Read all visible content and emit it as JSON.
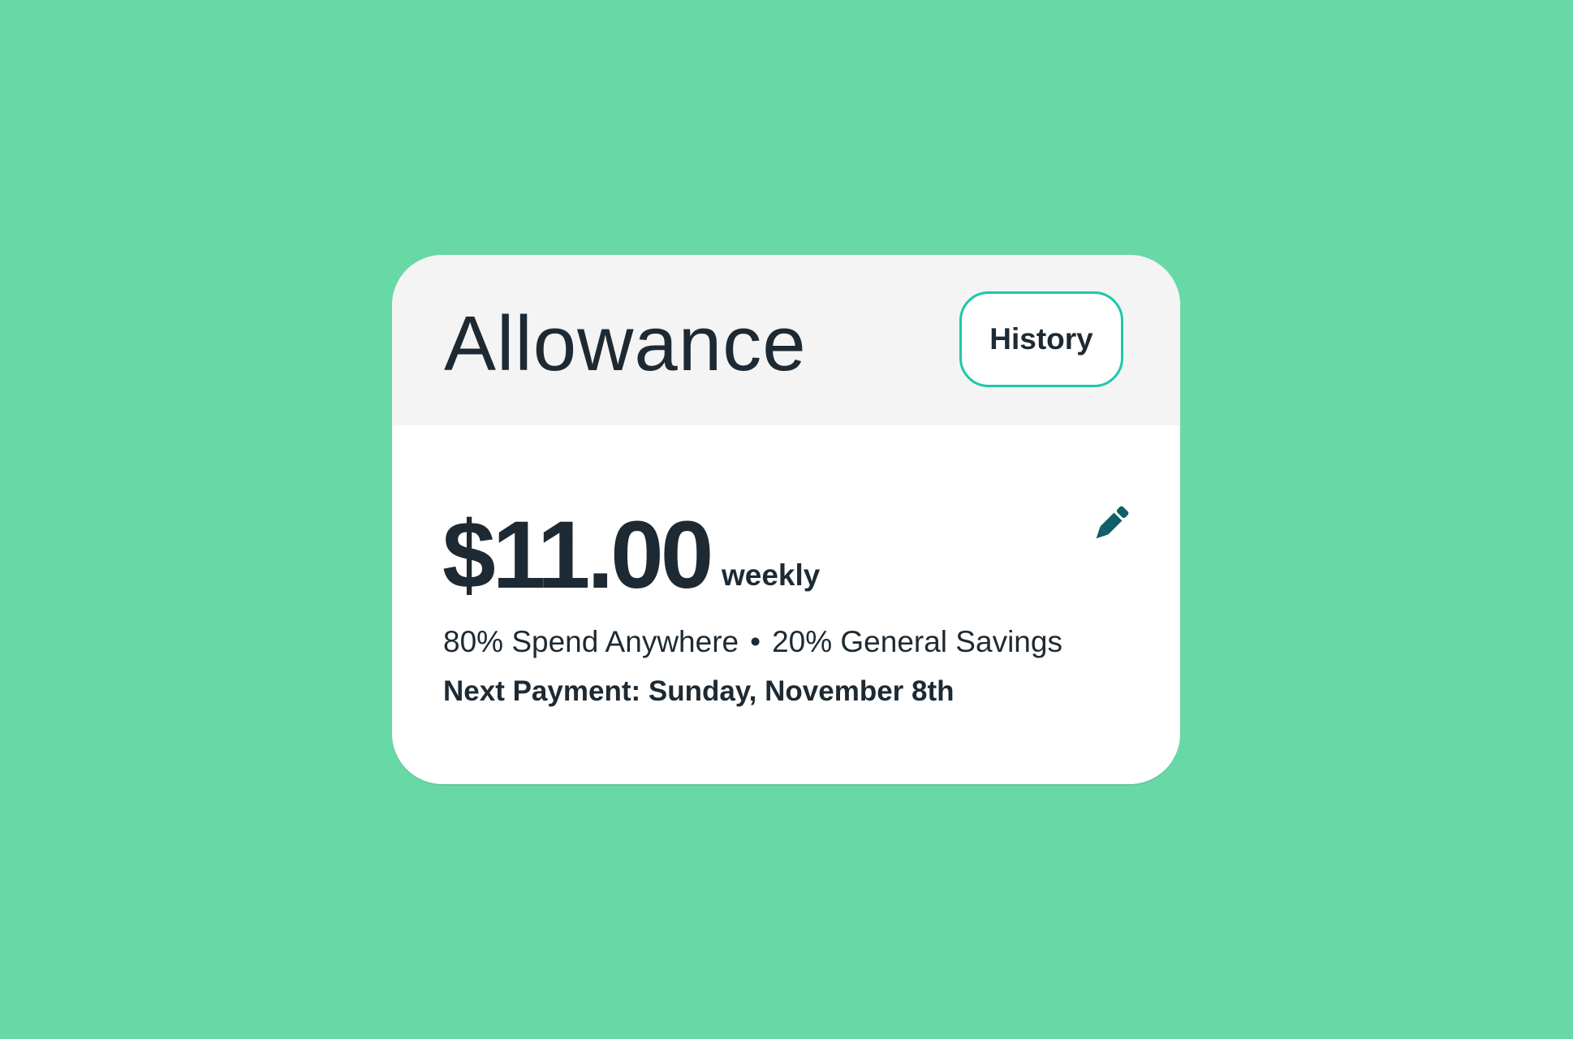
{
  "colors": {
    "background": "#69d8a7",
    "card": "#ffffff",
    "header": "#f4f4f4",
    "text": "#1e2a33",
    "accent_border": "#1ec7a9",
    "edit_icon": "#0f5e69"
  },
  "card": {
    "title": "Allowance",
    "history_label": "History",
    "amount": "$11.00",
    "frequency": "weekly",
    "edit_icon": "pencil-icon",
    "split": {
      "spend": "80% Spend Anywhere",
      "separator": "•",
      "savings": "20% General Savings"
    },
    "next_payment": "Next Payment: Sunday, November 8th"
  }
}
